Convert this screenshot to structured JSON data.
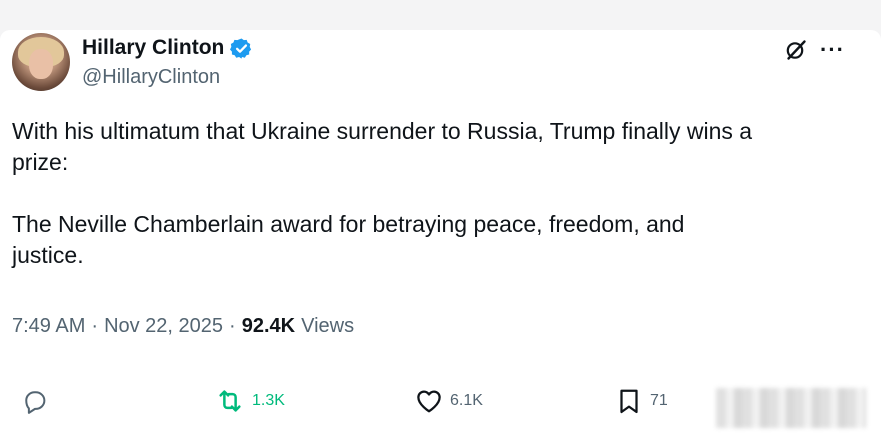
{
  "author": {
    "name": "Hillary Clinton",
    "handle": "@HillaryClinton",
    "verified_icon": "verified-badge-icon",
    "verified_color": "#1d9bf0"
  },
  "header_actions": {
    "grok_icon": "grok-icon",
    "more_label": "···"
  },
  "tweet": {
    "text": "With his ultimatum that Ukraine surrender to Russia, Trump finally wins a\nprize:\n\nThe Neville Chamberlain award for betraying peace, freedom, and\njustice."
  },
  "meta": {
    "time": "7:49 AM",
    "separator": "·",
    "date": "Nov 22, 2025",
    "views_count": "92.4K",
    "views_label": "Views"
  },
  "actions": {
    "reply": {
      "icon": "reply-icon",
      "count": ""
    },
    "repost": {
      "icon": "repost-icon",
      "count": "1.3K",
      "color": "#00ba7c"
    },
    "like": {
      "icon": "heart-icon",
      "count": "6.1K"
    },
    "bookmark": {
      "icon": "bookmark-icon",
      "count": "71"
    }
  }
}
